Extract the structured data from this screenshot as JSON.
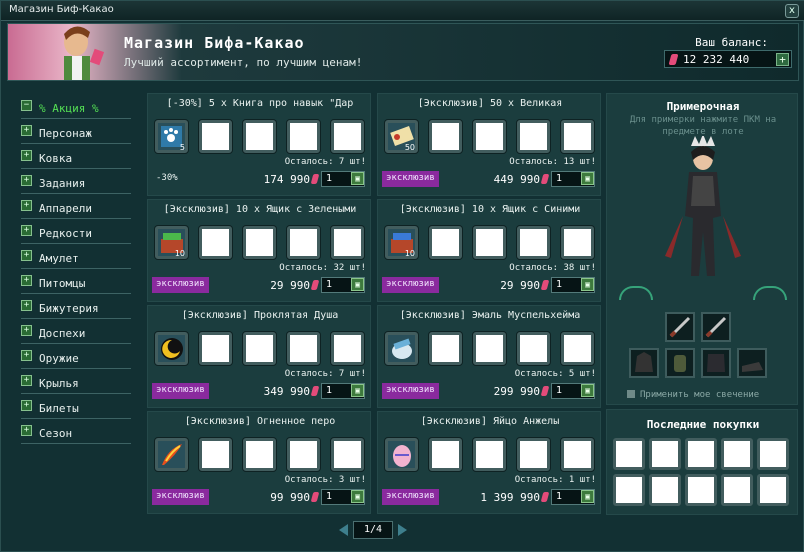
{
  "window": {
    "title": "Магазин Биф-Какао",
    "close": "x"
  },
  "banner": {
    "shop_name": "Магазин Бифа-Какао",
    "subtitle": "Лучший ассортимент, по лучшим ценам!",
    "balance_label": "Ваш баланс:",
    "balance_value": "12 232 440"
  },
  "sidebar": {
    "items": [
      {
        "label": "% Акция %",
        "active": true
      },
      {
        "label": "Персонаж"
      },
      {
        "label": "Ковка"
      },
      {
        "label": "Задания"
      },
      {
        "label": "Аппарели"
      },
      {
        "label": "Редкости"
      },
      {
        "label": "Амулет"
      },
      {
        "label": "Питомцы"
      },
      {
        "label": "Бижутерия"
      },
      {
        "label": "Доспехи"
      },
      {
        "label": "Оружие"
      },
      {
        "label": "Крылья"
      },
      {
        "label": "Билеты"
      },
      {
        "label": "Сезон"
      }
    ]
  },
  "cards": [
    {
      "name": "[-30%] 5 x Книга про навык \"Дар",
      "count": "5",
      "left": "Осталось: 7 шт!",
      "badge": "-30%",
      "price": "174 990",
      "qty": "1",
      "icon": "pawbook-icon"
    },
    {
      "name": "[Эксклюзив] 50 х Великая",
      "count": "50",
      "left": "Осталось: 13 шт!",
      "badge": "эксклюзив",
      "price": "449 990",
      "qty": "1",
      "icon": "scroll-icon"
    },
    {
      "name": "[Эксклюзив] 10 х Ящик с Зелеными",
      "count": "10",
      "left": "Осталось: 32 шт!",
      "badge": "эксклюзив",
      "price": "29 990",
      "qty": "1",
      "icon": "green-box-icon"
    },
    {
      "name": "[Эксклюзив] 10 х Ящик с Синими",
      "count": "10",
      "left": "Осталось: 38 шт!",
      "badge": "эксклюзив",
      "price": "29 990",
      "qty": "1",
      "icon": "blue-box-icon"
    },
    {
      "name": "[Эксклюзив] Проклятая Душа",
      "count": "",
      "left": "Осталось: 7 шт!",
      "badge": "эксклюзив",
      "price": "349 990",
      "qty": "1",
      "icon": "cursed-soul-icon"
    },
    {
      "name": "[Эксклюзив] Эмаль Муспельхейма",
      "count": "",
      "left": "Осталось: 5 шт!",
      "badge": "эксклюзив",
      "price": "299 990",
      "qty": "1",
      "icon": "enamel-icon"
    },
    {
      "name": "[Эксклюзив] Огненное перо",
      "count": "",
      "left": "Осталось: 3 шт!",
      "badge": "эксклюзив",
      "price": "99 990",
      "qty": "1",
      "icon": "fire-feather-icon"
    },
    {
      "name": "[Эксклюзив] Яйцо Анжелы",
      "count": "",
      "left": "Осталось: 1 шт!",
      "badge": "эксклюзив",
      "price": "1 399 990",
      "qty": "1",
      "icon": "egg-icon"
    }
  ],
  "pager": {
    "page": "1/4"
  },
  "fitting": {
    "title": "Примерочная",
    "hint": "Для примерки нажмите ПКМ на предмете в лоте",
    "apply": "Применить мое свечение"
  },
  "recent": {
    "title": "Последние покупки"
  },
  "colors": {
    "exclusive_badge": "#8a2a9e",
    "active_menu": "#54e054",
    "gem": "#e34b7a"
  }
}
